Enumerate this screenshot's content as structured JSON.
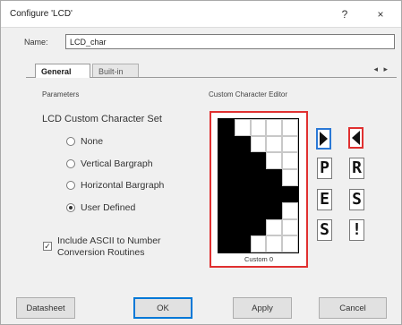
{
  "window": {
    "title": "Configure 'LCD'",
    "help_glyph": "?",
    "close_glyph": "×"
  },
  "name": {
    "label": "Name:",
    "value": "LCD_char"
  },
  "tabs": {
    "active": "General",
    "inactive": "Built-in",
    "scroll_glyph": "◂ ▸"
  },
  "parameters": {
    "label": "Parameters",
    "group_title": "LCD Custom Character Set",
    "options": [
      {
        "label": "None",
        "selected": false
      },
      {
        "label": "Vertical Bargraph",
        "selected": false
      },
      {
        "label": "Horizontal Bargraph",
        "selected": false
      },
      {
        "label": "User Defined",
        "selected": true
      }
    ],
    "ascii_checkbox": {
      "label": "Include ASCII to Number Conversion Routines",
      "checked": true,
      "check_glyph": "✓"
    }
  },
  "editor": {
    "label": "Custom Character Editor",
    "caption": "Custom 0",
    "pixels": [
      [
        1,
        0,
        0,
        0,
        0
      ],
      [
        1,
        1,
        0,
        0,
        0
      ],
      [
        1,
        1,
        1,
        0,
        0
      ],
      [
        1,
        1,
        1,
        1,
        0
      ],
      [
        1,
        1,
        1,
        1,
        1
      ],
      [
        1,
        1,
        1,
        1,
        0
      ],
      [
        1,
        1,
        1,
        0,
        0
      ],
      [
        1,
        1,
        0,
        0,
        0
      ]
    ]
  },
  "thumbnails": [
    {
      "char": "right-triangle",
      "selected": "blue"
    },
    {
      "char": "left-triangle",
      "selected": "red"
    },
    {
      "char": "P"
    },
    {
      "char": "R"
    },
    {
      "char": "E"
    },
    {
      "char": "S"
    },
    {
      "char": "S"
    },
    {
      "char": "!"
    }
  ],
  "footer": {
    "datasheet": "Datasheet",
    "ok": "OK",
    "apply": "Apply",
    "cancel": "Cancel"
  },
  "colors": {
    "highlight_red": "#e03030",
    "highlight_blue": "#2a78d6"
  }
}
